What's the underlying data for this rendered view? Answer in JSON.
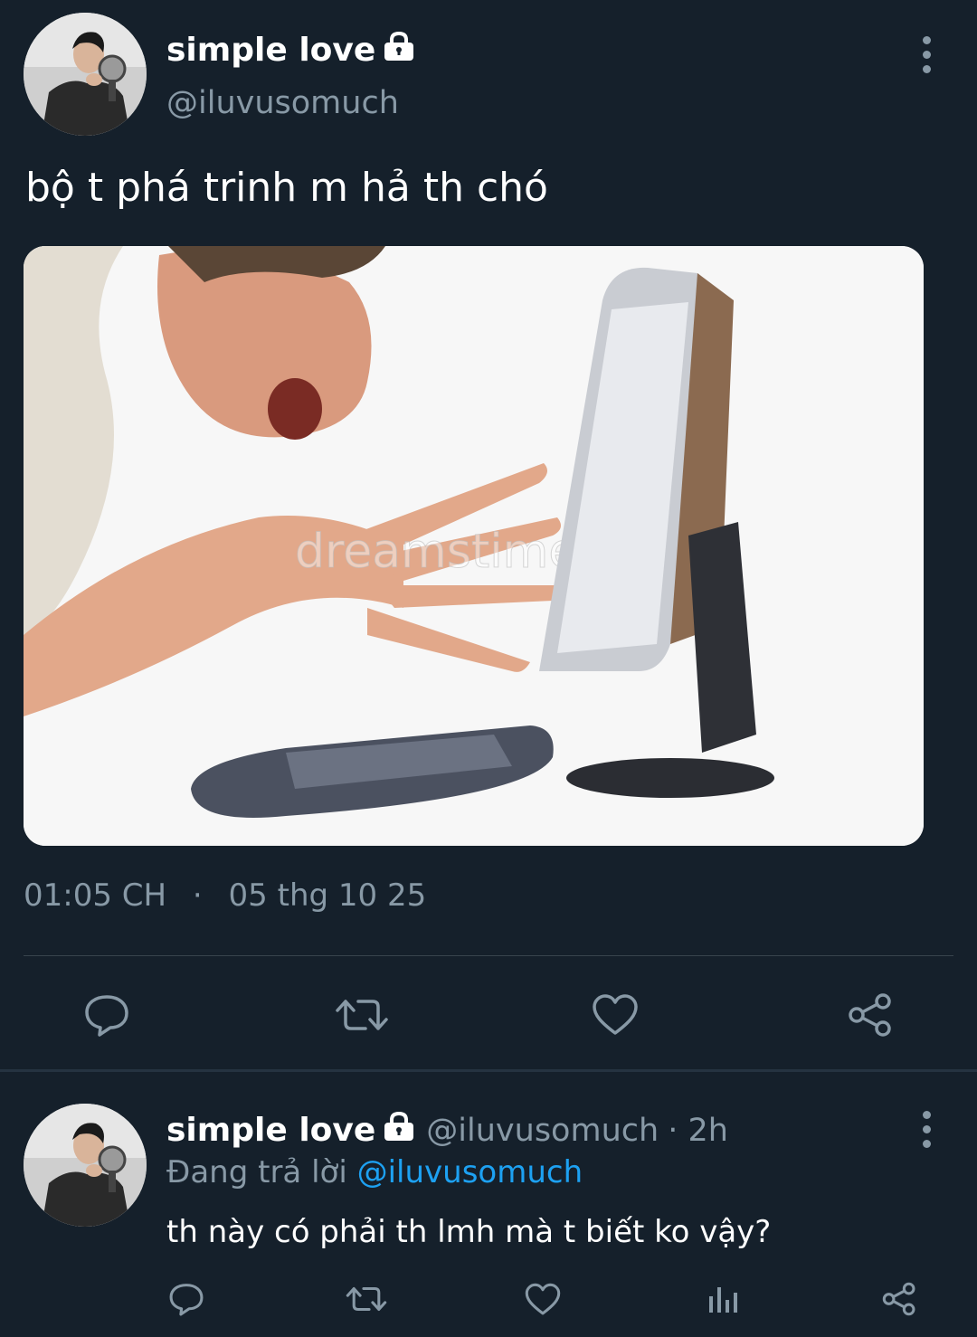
{
  "tweet": {
    "author_name": "simple love",
    "author_handle": "@iluvusomuch",
    "author_protected_icon": "lock-icon",
    "text": "bộ t phá trinh m hả th chó",
    "time": "01:05 CH",
    "separator": "·",
    "date": "05 thg 10 25",
    "media_watermark": "dreamstime",
    "actions": {
      "reply_icon": "reply-icon",
      "retweet_icon": "retweet-icon",
      "like_icon": "heart-icon",
      "share_icon": "share-icon"
    }
  },
  "reply": {
    "author_name": "simple love",
    "author_handle": "@iluvusomuch",
    "time": "· 2h",
    "replying_prefix": "Đang trả lời",
    "replying_to": "@iluvusomuch",
    "text": "th này có phải th lmh mà t biết ko vậy?",
    "actions": {
      "reply_icon": "reply-icon",
      "retweet_icon": "retweet-icon",
      "like_icon": "heart-icon",
      "analytics_icon": "analytics-icon",
      "share_icon": "share-icon"
    }
  },
  "colors": {
    "background": "#15202b",
    "text": "#ffffff",
    "secondary": "#8899a6",
    "link": "#1da1f2",
    "divider": "#38444d"
  }
}
